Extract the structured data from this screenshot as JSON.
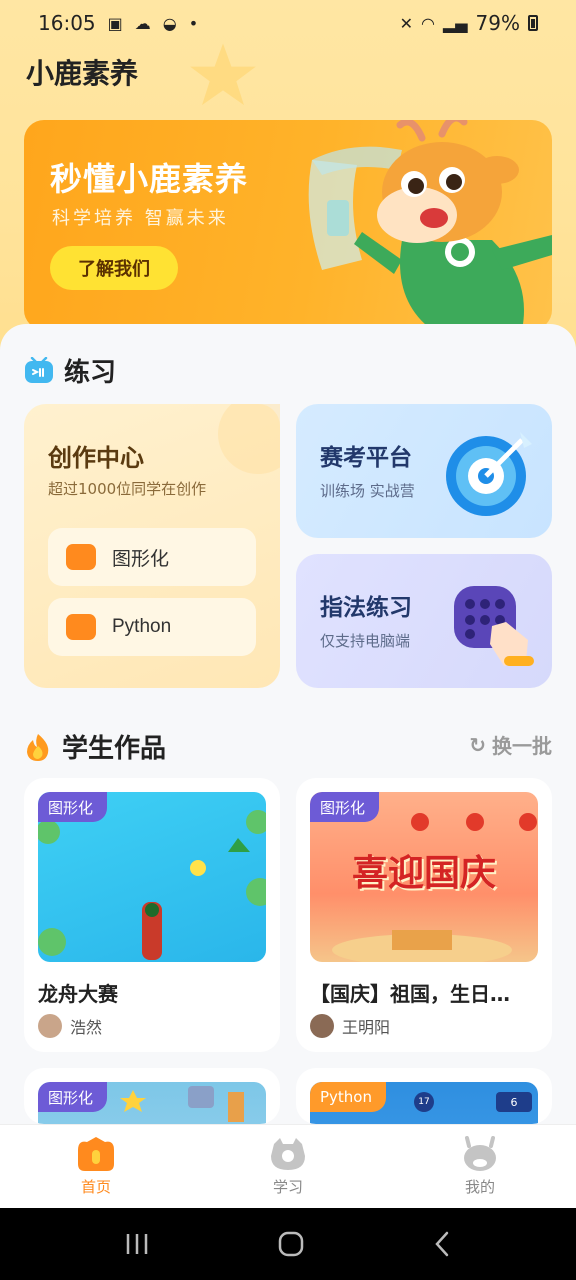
{
  "status_bar": {
    "time": "16:05",
    "battery": "79%"
  },
  "app_title": "小鹿素养",
  "banner": {
    "title": "秒懂小鹿素养",
    "subtitle": "科学培养 智赢未来",
    "button": "了解我们"
  },
  "practice": {
    "title": "练习",
    "create": {
      "title": "创作中心",
      "subtitle": "超过1000位同学在创作",
      "options": [
        "图形化",
        "Python"
      ]
    },
    "exam": {
      "title": "赛考平台",
      "subtitle": "训练场 实战营"
    },
    "finger": {
      "title": "指法练习",
      "subtitle": "仅支持电脑端"
    }
  },
  "works": {
    "title": "学生作品",
    "refresh": "换一批",
    "items": [
      {
        "tag": "图形化",
        "title": "龙舟大赛",
        "author": "浩然"
      },
      {
        "tag": "图形化",
        "title": "【国庆】祖国，生日…",
        "author": "王明阳",
        "image_text": "喜迎国庆"
      },
      {
        "tag": "图形化"
      },
      {
        "tag": "Python",
        "badges": [
          "17",
          "6"
        ]
      }
    ]
  },
  "tabs": [
    {
      "label": "首页",
      "active": true
    },
    {
      "label": "学习"
    },
    {
      "label": "我的"
    }
  ],
  "colors": {
    "accent": "#ff8a1e",
    "banner": "#ffa61c",
    "tag": "#6d5bd6"
  }
}
